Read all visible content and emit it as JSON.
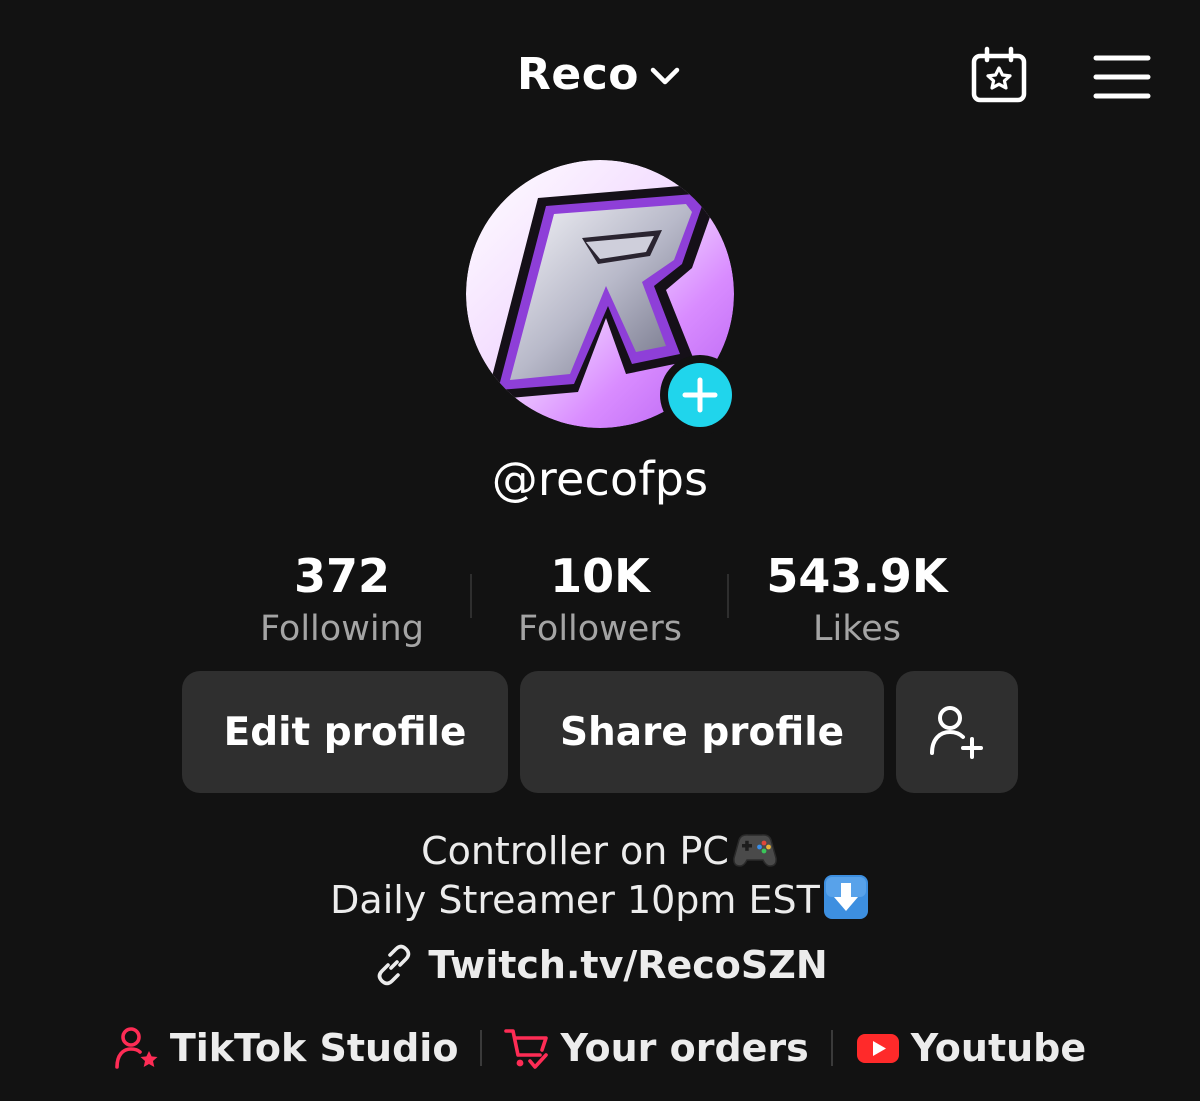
{
  "header": {
    "account_name": "Reco",
    "calendar_icon": "calendar-star-icon",
    "menu_icon": "hamburger-menu-icon"
  },
  "profile": {
    "handle": "@recofps",
    "avatar_icon": "r-logo-avatar",
    "add_icon": "plus-icon"
  },
  "stats": [
    {
      "value": "372",
      "label": "Following"
    },
    {
      "value": "10K",
      "label": "Followers"
    },
    {
      "value": "543.9K",
      "label": "Likes"
    }
  ],
  "actions": {
    "edit_label": "Edit profile",
    "share_label": "Share profile",
    "add_friend_icon": "add-friend-icon"
  },
  "bio": {
    "line1": "Controller on PC",
    "line1_emoji": "game-controller-icon",
    "line2": "Daily Streamer 10pm EST",
    "line2_emoji": "down-arrow-icon"
  },
  "link": {
    "text": "Twitch.tv/RecoSZN",
    "icon": "link-icon"
  },
  "shortcuts": [
    {
      "label": "TikTok Studio",
      "icon": "person-star-icon"
    },
    {
      "label": "Your orders",
      "icon": "cart-icon"
    },
    {
      "label": "Youtube",
      "icon": "youtube-icon"
    }
  ],
  "colors": {
    "background": "#121212",
    "accent_cyan": "#20d5ec",
    "accent_red": "#fe2c55",
    "button_bg": "#2f2f2f",
    "youtube_red": "#ff0000"
  }
}
